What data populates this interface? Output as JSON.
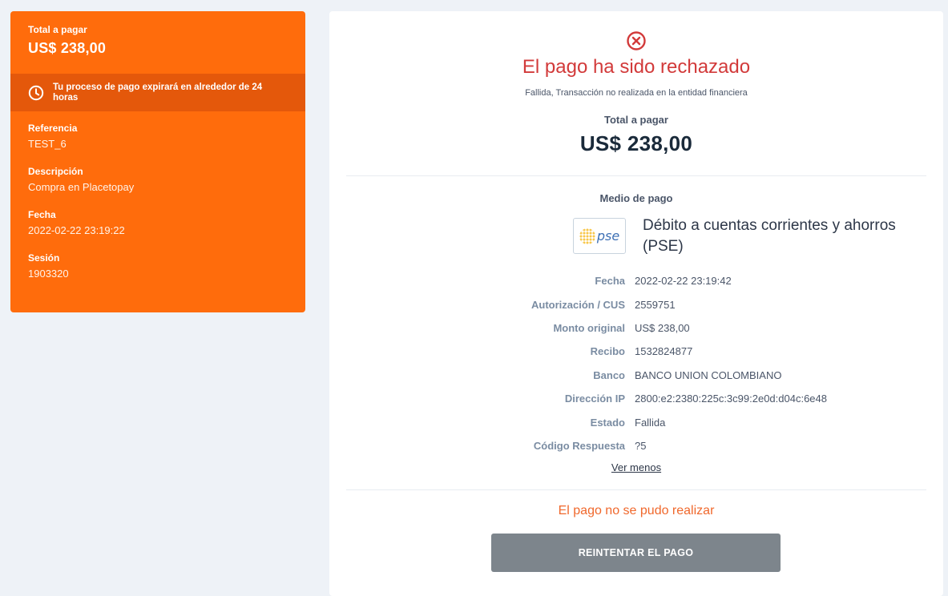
{
  "summary": {
    "total_label": "Total a pagar",
    "total_amount": "US$ 238,00",
    "expire_notice": "Tu proceso de pago expirará en alrededor de 24 horas",
    "items": [
      {
        "label": "Referencia",
        "value": "TEST_6"
      },
      {
        "label": "Descripción",
        "value": "Compra en Placetopay"
      },
      {
        "label": "Fecha",
        "value": "2022-02-22 23:19:22"
      },
      {
        "label": "Sesión",
        "value": "1903320"
      }
    ],
    "colors": {
      "panel": "#ff6c0c",
      "expire_band": "#e4580b"
    }
  },
  "result": {
    "icon": "x-circle-icon",
    "title": "El pago ha sido rechazado",
    "subtitle": "Fallida, Transacción no realizada en la entidad financiera",
    "total_label": "Total a pagar",
    "total_amount": "US$ 238,00",
    "colors": {
      "title": "#d23a3a"
    }
  },
  "payment_method": {
    "label": "Medio de pago",
    "logo_text": "pse",
    "name": "Débito a cuentas corrientes y ahorros (PSE)"
  },
  "details": [
    {
      "label": "Fecha",
      "value": "2022-02-22 23:19:42"
    },
    {
      "label": "Autorización / CUS",
      "value": "2559751"
    },
    {
      "label": "Monto original",
      "value": "US$ 238,00"
    },
    {
      "label": "Recibo",
      "value": "1532824877"
    },
    {
      "label": "Banco",
      "value": "BANCO UNION COLOMBIANO"
    },
    {
      "label": "Dirección IP",
      "value": "2800:e2:2380:225c:3c99:2e0d:d04c:6e48"
    },
    {
      "label": "Estado",
      "value": "Fallida"
    },
    {
      "label": "Código Respuesta",
      "value": "?5"
    }
  ],
  "toggle_link": "Ver menos",
  "failure_message": "El pago no se pudo realizar",
  "retry_button": "REINTENTAR EL PAGO"
}
